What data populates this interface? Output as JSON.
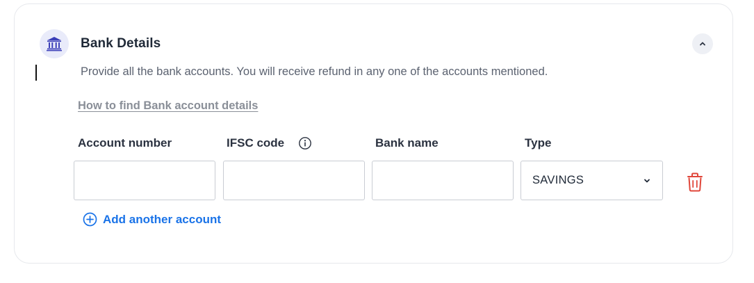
{
  "section": {
    "title": "Bank Details",
    "description": "Provide all the bank accounts. You will receive refund in any one of the accounts mentioned.",
    "help_link": "How to find Bank account details",
    "icon": "bank-icon",
    "collapse_icon": "chevron-up-icon"
  },
  "columns": {
    "account_number": "Account number",
    "ifsc_code": "IFSC code",
    "bank_name": "Bank name",
    "type": "Type"
  },
  "accounts": [
    {
      "account_number": "",
      "ifsc_code": "",
      "bank_name": "",
      "type": "SAVINGS"
    }
  ],
  "add_account_label": "Add another account",
  "colors": {
    "accent": "#1a73e8",
    "danger": "#e0463a",
    "icon_bg": "#e9ebfa",
    "icon_fg": "#3b3fb8"
  }
}
